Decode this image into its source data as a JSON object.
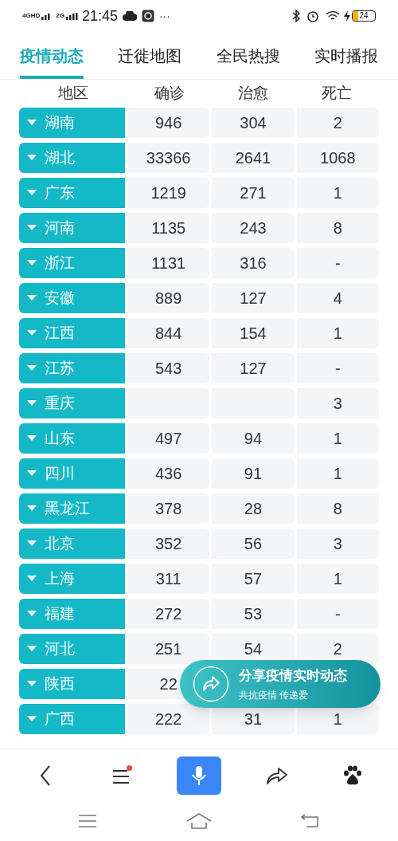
{
  "status_bar": {
    "network_1": "4GHD",
    "network_2": "2G",
    "time": "21:45",
    "more": "···",
    "battery": "24"
  },
  "tabs": [
    {
      "label": "疫情动态",
      "selected": true
    },
    {
      "label": "迁徙地图",
      "selected": false
    },
    {
      "label": "全民热搜",
      "selected": false
    },
    {
      "label": "实时播报",
      "selected": false
    }
  ],
  "table": {
    "columns": [
      "地区",
      "确诊",
      "治愈",
      "死亡"
    ],
    "rows": [
      {
        "region": "湖南",
        "confirmed": "946",
        "cured": "304",
        "deaths": "2"
      },
      {
        "region": "湖北",
        "confirmed": "33366",
        "cured": "2641",
        "deaths": "1068"
      },
      {
        "region": "广东",
        "confirmed": "1219",
        "cured": "271",
        "deaths": "1"
      },
      {
        "region": "河南",
        "confirmed": "1135",
        "cured": "243",
        "deaths": "8"
      },
      {
        "region": "浙江",
        "confirmed": "1131",
        "cured": "316",
        "deaths": "-"
      },
      {
        "region": "安徽",
        "confirmed": "889",
        "cured": "127",
        "deaths": "4"
      },
      {
        "region": "江西",
        "confirmed": "844",
        "cured": "154",
        "deaths": "1"
      },
      {
        "region": "江苏",
        "confirmed": "543",
        "cured": "127",
        "deaths": "-"
      },
      {
        "region": "重庆",
        "deaths": "3"
      },
      {
        "region": "山东",
        "confirmed": "497",
        "cured": "94",
        "deaths": "1"
      },
      {
        "region": "四川",
        "confirmed": "436",
        "cured": "91",
        "deaths": "1"
      },
      {
        "region": "黑龙江",
        "confirmed": "378",
        "cured": "28",
        "deaths": "8"
      },
      {
        "region": "北京",
        "confirmed": "352",
        "cured": "56",
        "deaths": "3"
      },
      {
        "region": "上海",
        "confirmed": "311",
        "cured": "57",
        "deaths": "1"
      },
      {
        "region": "福建",
        "confirmed": "272",
        "cured": "53",
        "deaths": "-"
      },
      {
        "region": "河北",
        "confirmed": "251",
        "cured": "54",
        "deaths": "2"
      },
      {
        "region": "陕西",
        "confirmed": "22"
      },
      {
        "region": "广西",
        "confirmed": "222",
        "cured": "31",
        "deaths": "1"
      }
    ]
  },
  "share_card": {
    "title": "分享疫情实时动态",
    "subtitle": "共抗疫情 传递爱"
  },
  "toolbar": {
    "notification_dot": true
  }
}
